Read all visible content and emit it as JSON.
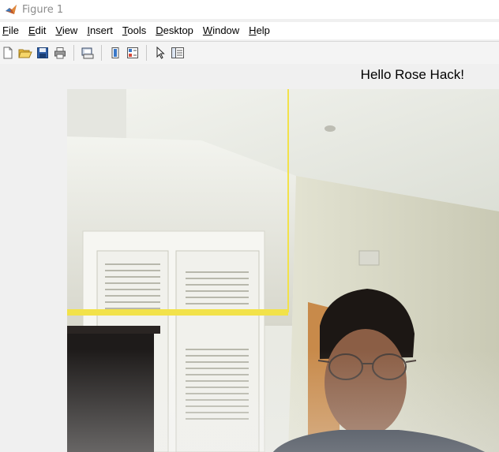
{
  "window": {
    "title": "Figure 1",
    "icon": "matlab-icon"
  },
  "menu": [
    {
      "label": "File",
      "accel": "F",
      "rest": "ile"
    },
    {
      "label": "Edit",
      "accel": "E",
      "rest": "dit"
    },
    {
      "label": "View",
      "accel": "V",
      "rest": "iew"
    },
    {
      "label": "Insert",
      "accel": "I",
      "rest": "nsert"
    },
    {
      "label": "Tools",
      "accel": "T",
      "rest": "ools"
    },
    {
      "label": "Desktop",
      "accel": "D",
      "rest": "esktop"
    },
    {
      "label": "Window",
      "accel": "W",
      "rest": "indow"
    },
    {
      "label": "Help",
      "accel": "H",
      "rest": "elp"
    }
  ],
  "toolbar": {
    "buttons": [
      "new-figure-icon",
      "open-file-icon",
      "save-icon",
      "print-icon",
      "print-preview-icon",
      "link-plot-icon",
      "insert-colorbar-icon",
      "edit-plot-arrow-icon",
      "property-inspector-icon"
    ]
  },
  "figure": {
    "overlay_text": "Hello Rose Hack!",
    "box_color": "#f2e24a"
  }
}
